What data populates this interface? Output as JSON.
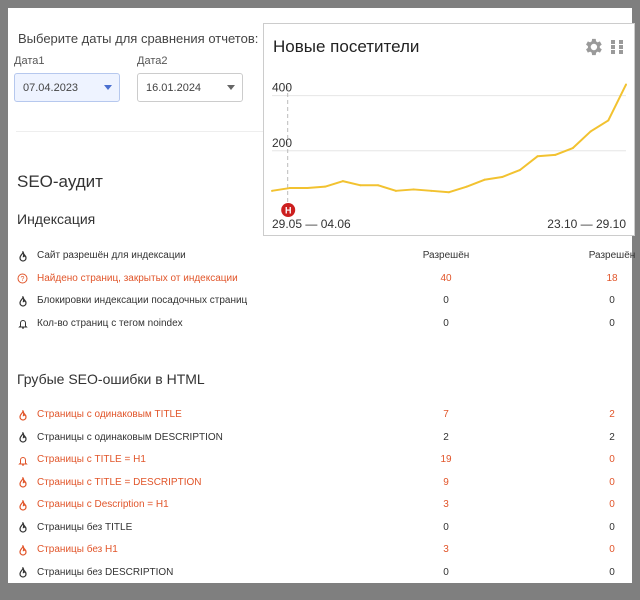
{
  "compare": {
    "title": "Выберите даты для сравнения отчетов:",
    "date1_label": "Дата1",
    "date1_value": "07.04.2023",
    "date2_label": "Дата2",
    "date2_value": "16.01.2024"
  },
  "audit": {
    "title": "SEO-аудит",
    "indexing": {
      "title": "Индексация",
      "rows": [
        {
          "label": "Сайт разрешён для индексации",
          "v1": "Разрешён",
          "v2": "Разрешён",
          "icon": "fire-icon",
          "status": "ok"
        },
        {
          "label": "Найдено страниц, закрытых от индексации",
          "v1": "40",
          "v2": "18",
          "icon": "question-icon",
          "status": "err"
        },
        {
          "label": "Блокировки индексации посадочных страниц",
          "v1": "0",
          "v2": "0",
          "icon": "fire-icon",
          "status": "ok"
        },
        {
          "label": "Кол-во страниц с тегом noindex",
          "v1": "0",
          "v2": "0",
          "icon": "bell-icon",
          "status": "ok"
        }
      ]
    },
    "html_errors": {
      "title": "Грубые SEO-ошибки в HTML",
      "rows": [
        {
          "label": "Страницы с одинаковым TITLE",
          "v1": "7",
          "v2": "2",
          "icon": "fire-icon",
          "status": "err"
        },
        {
          "label": "Страницы с одинаковым DESCRIPTION",
          "v1": "2",
          "v2": "2",
          "icon": "fire-icon",
          "status": "ok"
        },
        {
          "label": "Страницы с TITLE = H1",
          "v1": "19",
          "v2": "0",
          "icon": "bell-icon",
          "status": "err"
        },
        {
          "label": "Страницы с TITLE = DESCRIPTION",
          "v1": "9",
          "v2": "0",
          "icon": "fire-icon",
          "status": "err"
        },
        {
          "label": "Страницы с Description = H1",
          "v1": "3",
          "v2": "0",
          "icon": "fire-icon",
          "status": "err"
        },
        {
          "label": "Страницы без TITLE",
          "v1": "0",
          "v2": "0",
          "icon": "fire-icon",
          "status": "ok"
        },
        {
          "label": "Страницы без H1",
          "v1": "3",
          "v2": "0",
          "icon": "fire-icon",
          "status": "err"
        },
        {
          "label": "Страницы без DESCRIPTION",
          "v1": "0",
          "v2": "0",
          "icon": "fire-icon",
          "status": "ok"
        }
      ]
    }
  },
  "widget": {
    "title": "Новые посетители",
    "gear_icon": "gear-icon",
    "grid_icon": "grid-icon",
    "marker_label": "H",
    "x_label_start": "29.05 — 04.06",
    "x_label_end": "23.10 — 29.10"
  },
  "colors": {
    "error": "#e1552a",
    "line": "#f2c230",
    "marker": "#cc1f1f"
  },
  "chart_data": {
    "type": "line",
    "title": "Новые посетители",
    "x_tick_labels": [
      "29.05 — 04.06",
      "23.10 — 29.10"
    ],
    "y_ticks": [
      200,
      400
    ],
    "ylim": [
      0,
      460
    ],
    "grid": true,
    "series": [
      {
        "values": [
          55,
          65,
          65,
          70,
          90,
          75,
          75,
          55,
          60,
          55,
          50,
          70,
          95,
          105,
          130,
          180,
          185,
          210,
          270,
          310,
          440
        ]
      }
    ]
  }
}
